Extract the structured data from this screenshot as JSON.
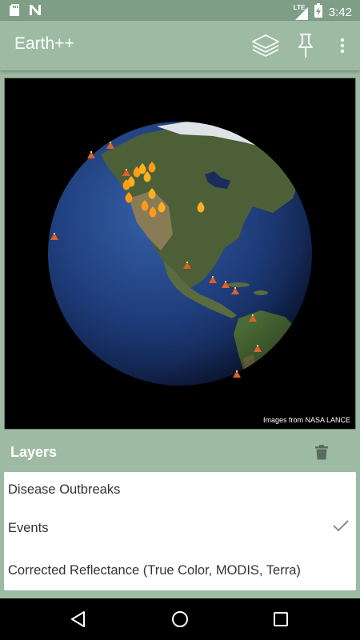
{
  "status_bar": {
    "network": "LTE",
    "time": "3:42",
    "icons": [
      "sd-card-icon",
      "notification-n-icon",
      "signal-icon",
      "battery-charging-icon"
    ]
  },
  "app_bar": {
    "title": "Earth++",
    "actions": [
      "layers-icon",
      "pin-icon",
      "more-vert-icon"
    ]
  },
  "globe": {
    "credit": "Images from NASA LANCE",
    "markers": {
      "fires": 12,
      "volcanoes": 11
    }
  },
  "layers": {
    "title": "Layers",
    "items": [
      {
        "label": "Disease Outbreaks",
        "checked": false
      },
      {
        "label": "Events",
        "checked": true
      },
      {
        "label": "Corrected Reflectance (True Color, MODIS, Terra)",
        "checked": false
      }
    ]
  },
  "colors": {
    "primary": "#9dbba2",
    "status_bar": "#7f9e86",
    "ocean": "#1e3b78",
    "land": "#5a6b3f"
  }
}
